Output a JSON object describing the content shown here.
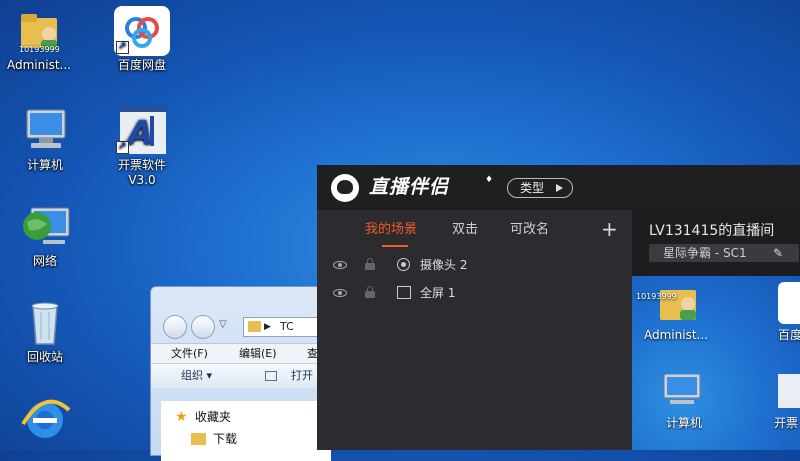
{
  "desktop": {
    "icons": [
      {
        "label": "Administ...",
        "overlay": "10193999",
        "icon": "user-folder-icon"
      },
      {
        "label": "百度网盘",
        "icon": "baidu-netdisk-icon"
      },
      {
        "label": "计算机",
        "icon": "computer-icon"
      },
      {
        "label": "开票软件",
        "label2": "V3.0",
        "icon": "invoice-software-icon"
      },
      {
        "label": "网络",
        "icon": "network-icon"
      },
      {
        "label": "回收站",
        "icon": "recycle-bin-icon"
      },
      {
        "label": "",
        "icon": "internet-explorer-icon"
      }
    ]
  },
  "explorer": {
    "path_text": "TC",
    "menu": [
      "文件(F)",
      "编辑(E)",
      "查"
    ],
    "toolbar": {
      "organize": "组织 ▾",
      "open": "打开"
    },
    "nav": [
      {
        "label": "收藏夹",
        "icon": "star-icon"
      },
      {
        "label": "下载",
        "icon": "download-folder-icon"
      }
    ]
  },
  "app": {
    "brand": "直播伴侣",
    "type_button": "类型",
    "tabs": [
      "我的场景",
      "双击",
      "可改名"
    ],
    "add_label": "+",
    "scenes": [
      {
        "label": "摄像头 2",
        "icon": "camera-icon"
      },
      {
        "label": "全屏 1",
        "icon": "fullscreen-icon"
      }
    ],
    "room_title": "LV131415的直播间",
    "game_tag": "星际争霸 - SC1",
    "edit_glyph": "✎",
    "preview": {
      "icons": [
        {
          "label": "Administ...",
          "overlay": "10193999"
        },
        {
          "label": "百度"
        },
        {
          "label": "计算机"
        },
        {
          "label": "开票"
        }
      ]
    }
  },
  "colors": {
    "accent": "#f25a27",
    "app_bg": "#2c2c30",
    "titlebar_bg": "#1f1f22",
    "desktop_blue": "#1e6fcf"
  }
}
